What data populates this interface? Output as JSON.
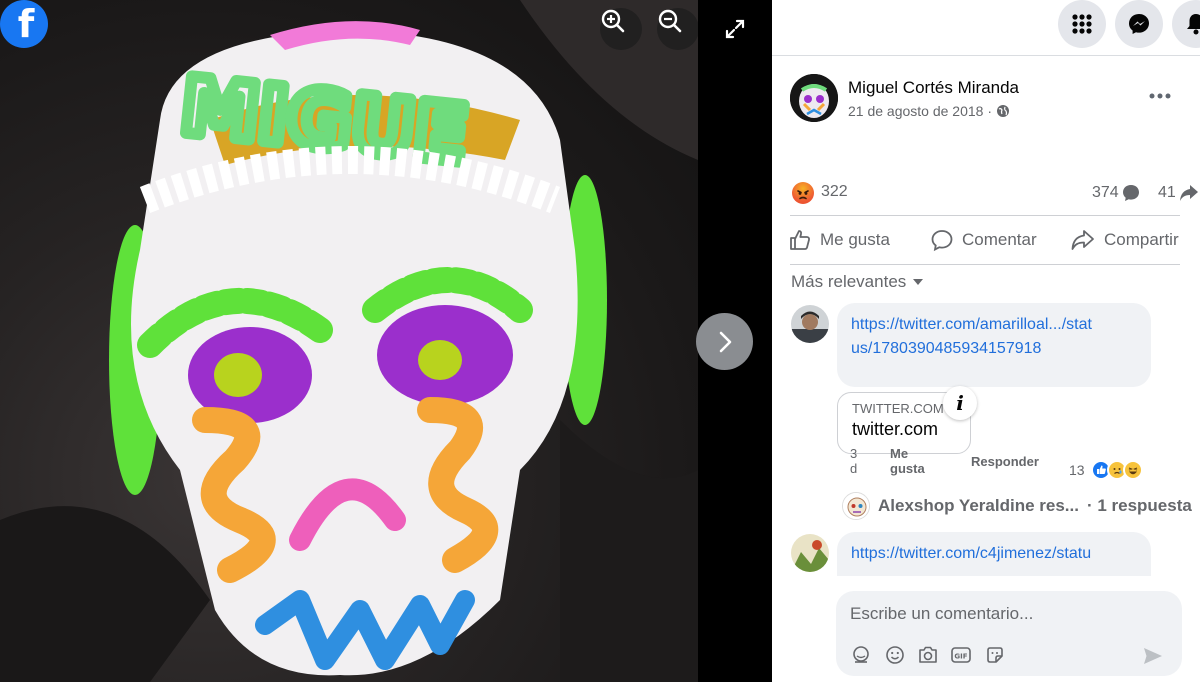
{
  "viewer": {
    "logo_glyph": "f",
    "controls": [
      "zoom-in",
      "zoom-out",
      "fullscreen",
      "next"
    ]
  },
  "topbar": {
    "icons": [
      "menu-grid-icon",
      "messenger-icon",
      "notifications-icon"
    ]
  },
  "post": {
    "author": "Miguel Cortés Miranda",
    "date": "21 de agosto de 2018 ·",
    "privacy_icon": "globe-icon",
    "reactions_count": "322",
    "reaction_type": "angry",
    "comments_count": "374",
    "shares_count": "41"
  },
  "actions": {
    "like": "Me gusta",
    "comment": "Comentar",
    "share": "Compartir"
  },
  "comments_header": {
    "sort_label": "Más relevantes"
  },
  "comments": [
    {
      "link_line1": "https://twitter.com/amarilloal.../stat",
      "link_line2": "us/1780390485934157918",
      "card_domain": "TWITTER.COM",
      "card_title": "twitter.com",
      "time": "3 d",
      "like_label": "Me gusta",
      "reply_label": "Responder",
      "reaction_count": "13",
      "reaction_types": [
        "like",
        "sad",
        "haha"
      ],
      "replies_author": "Alexshop Yeraldine res...",
      "replies_count": "· 1 respuesta"
    },
    {
      "link_line1": "https://twitter.com/c4jimenez/statu"
    }
  ],
  "composer": {
    "placeholder": "Escribe un comentario...",
    "tools": [
      "avatar-sticker-icon",
      "emoji-icon",
      "camera-icon",
      "gif-icon",
      "sticker-icon"
    ]
  },
  "colors": {
    "facebook_blue": "#1877f2",
    "link": "#216fdb",
    "secondary_text": "#65676b"
  }
}
